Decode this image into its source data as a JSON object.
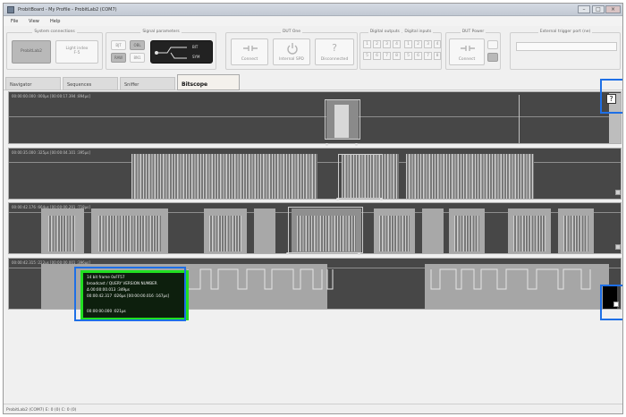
{
  "window": {
    "title": "ProbitBoard - My Profile - ProbitLab2 (COM7)"
  },
  "menu": [
    "File",
    "View",
    "Help"
  ],
  "ribbon": {
    "system_connections": {
      "title": "System connections",
      "probelab": "ProbitLab2",
      "light": "Light index",
      "light_sub": "F-5"
    },
    "signal_parameters": {
      "title": "Signal parameters",
      "b1": "BJT",
      "b2": "OBL",
      "b3": "RAW",
      "b4": "8N1",
      "sw_top": "BIT",
      "sw_bottom": "SYM"
    },
    "dut_one": {
      "title": "DUT One",
      "connect": "Connect",
      "internal": "Internal SPD",
      "disconnected": "Disconnected",
      "question": "?"
    },
    "digital": {
      "title1": "Digital outputs",
      "title2": "Digital inputs",
      "nums": [
        "1",
        "2",
        "3",
        "4",
        "5",
        "6",
        "7",
        "8"
      ]
    },
    "dut_power": {
      "title": "DUT Power",
      "connect": "Connect"
    },
    "external": {
      "title": "External trigger port (ne)"
    }
  },
  "tabs": [
    "Navigator",
    "Sequences",
    "Sniffer",
    "Bitscope"
  ],
  "active_tab": "Bitscope",
  "tracks": [
    {
      "timestamp": "00:00:00.000 :000µs  [00:00:17.394 :894µs]"
    },
    {
      "timestamp": "00:00:35.000 :325µs  [00:00:04.101 :395µs]"
    },
    {
      "timestamp": "00:00:42.176 :664µs  [00:00:00.291 :718µs]"
    },
    {
      "timestamp": "00:00:42.315 :222µs  [00:00:00.001 :396µs]"
    }
  ],
  "tooltip": {
    "line1": "14 bit frame  0xFF57",
    "line2": "broadcast / QUERY VERSION NUMBER",
    "line3": "Δ 00:00:00.013 :349µs",
    "line4": "00:00:42.317 :026µs  [00:00:00.016 :167µs]",
    "line5": "00:00:00.000 :021µs"
  },
  "help_icon": "?",
  "status": "ProbitLab2 (COM7)   E: 0 (0)   C: 0 (0)",
  "colors": {
    "track_bg": "#474747",
    "highlight": "#1e6fe6",
    "tooltip_border": "#21e021"
  }
}
